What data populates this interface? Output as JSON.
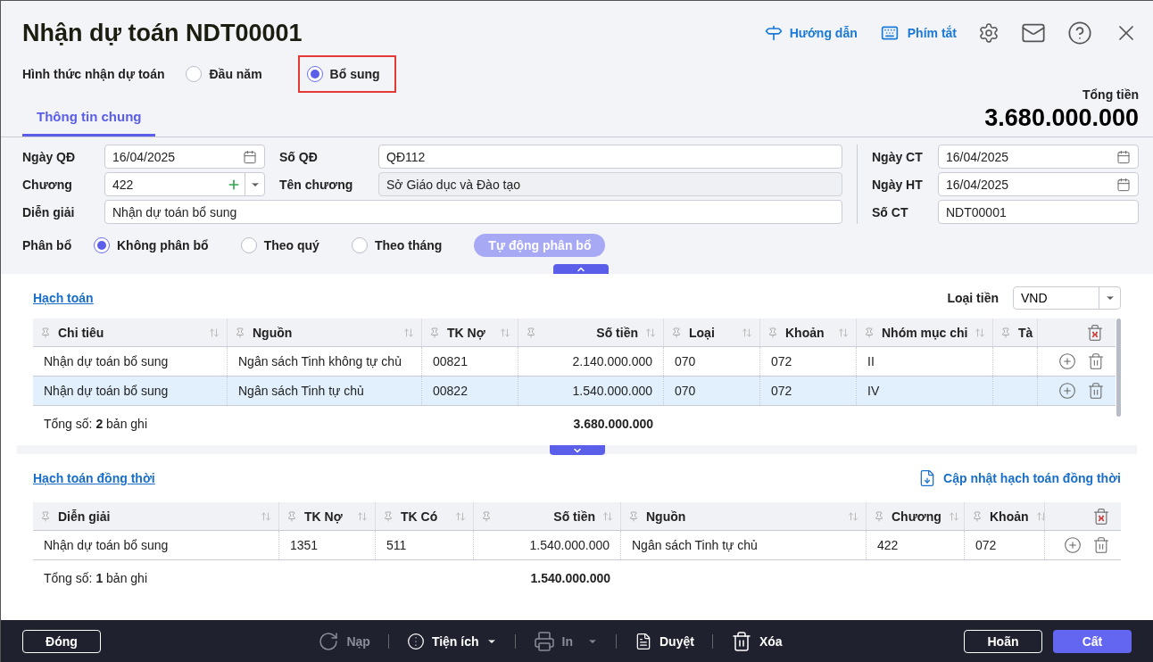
{
  "title": "Nhận dự toán NDT00001",
  "toolbar": [
    {
      "kind": "guide",
      "label": "Hướng dẫn"
    },
    {
      "kind": "keyboard",
      "label": "Phím tắt"
    },
    {
      "kind": "settings"
    },
    {
      "kind": "mail"
    },
    {
      "kind": "help"
    },
    {
      "kind": "close"
    }
  ],
  "receive_type": {
    "label": "Hình thức nhận dự toán",
    "options": [
      {
        "label": "Đầu năm",
        "selected": false,
        "highlighted": false
      },
      {
        "label": "Bổ sung",
        "selected": true,
        "highlighted": true
      }
    ]
  },
  "tabs": [
    {
      "label": "Thông tin chung",
      "selected": true
    }
  ],
  "total": {
    "label": "Tổng tiền",
    "value": "3.680.000.000"
  },
  "main_fields": [
    {
      "label": "Ngày QĐ",
      "value": "16/04/2025",
      "kind": "date"
    },
    {
      "label": "Số QĐ",
      "value": "QĐ112",
      "kind": "text"
    },
    {
      "label": "Chương",
      "value": "422",
      "kind": "combo"
    },
    {
      "label": "Tên chương",
      "value": "Sở Giáo dục và Đào tạo",
      "kind": "readonly"
    },
    {
      "label": "Diễn giải",
      "value": "Nhận dự toán bổ sung",
      "kind": "text"
    }
  ],
  "side_fields": [
    {
      "label": "Ngày CT",
      "value": "16/04/2025",
      "kind": "date"
    },
    {
      "label": "Ngày HT",
      "value": "16/04/2025",
      "kind": "date"
    },
    {
      "label": "Số CT",
      "value": "NDT00001",
      "kind": "text"
    }
  ],
  "allocation": {
    "label": "Phân bổ",
    "options": [
      {
        "label": "Không phân bổ",
        "selected": true
      },
      {
        "label": "Theo quý",
        "selected": false
      },
      {
        "label": "Theo tháng",
        "selected": false
      }
    ],
    "button": {
      "label": "Tự động phân bổ",
      "disabled": true
    }
  },
  "accounting": {
    "title": "Hạch toán",
    "currency": {
      "label": "Loại tiền",
      "value": "VND"
    },
    "columns": [
      {
        "label": "Chi tiêu"
      },
      {
        "label": "Nguồn"
      },
      {
        "label": "TK Nợ"
      },
      {
        "label": "Số tiền"
      },
      {
        "label": "Loại"
      },
      {
        "label": "Khoản"
      },
      {
        "label": "Nhóm mục chi"
      },
      {
        "label": "Tà"
      }
    ],
    "rows": [
      {
        "selected": false,
        "cells": [
          "Nhận dự toán bổ sung",
          "Ngân sách Tinh không tự chủ",
          "00821",
          "2.140.000.000",
          "070",
          "072",
          "II",
          ""
        ]
      },
      {
        "selected": true,
        "cells": [
          "Nhận dự toán bổ sung",
          "Ngân sách Tinh tự chủ",
          "00822",
          "1.540.000.000",
          "070",
          "072",
          "IV",
          ""
        ]
      }
    ],
    "summary": {
      "count": "Tổng số: **2** bản ghi",
      "total": "3.680.000.000"
    }
  },
  "concurrent": {
    "title": "Hạch toán đồng thời",
    "update_link": "Cập nhật hạch toán đồng thời",
    "columns": [
      {
        "label": "Diễn giải"
      },
      {
        "label": "TK Nợ"
      },
      {
        "label": "TK Có"
      },
      {
        "label": "Số tiền"
      },
      {
        "label": "Nguồn"
      },
      {
        "label": "Chương"
      },
      {
        "label": "Khoản"
      }
    ],
    "rows": [
      {
        "selected": false,
        "cells": [
          "Nhận dự toán bổ sung",
          "1351",
          "511",
          "1.540.000.000",
          "Ngân sách Tinh tự chủ",
          "422",
          "072"
        ]
      }
    ],
    "summary": {
      "count": "Tổng số: **1** bản ghi",
      "total": "1.540.000.000"
    }
  },
  "footer_buttons": [
    {
      "kind": "outline",
      "label": "Đóng",
      "disabled": false
    },
    {
      "kind": "reload",
      "label": "Nạp",
      "disabled": true
    },
    {
      "kind": "utilities",
      "label": "Tiện ích",
      "disabled": false
    },
    {
      "kind": "print",
      "label": "In",
      "disabled": true
    },
    {
      "kind": "approve",
      "label": "Duyệt",
      "disabled": false
    },
    {
      "kind": "delete",
      "label": "Xóa",
      "disabled": false
    },
    {
      "kind": "outline",
      "label": "Hoãn",
      "disabled": false
    },
    {
      "kind": "primary",
      "label": "Cất",
      "disabled": false
    }
  ]
}
